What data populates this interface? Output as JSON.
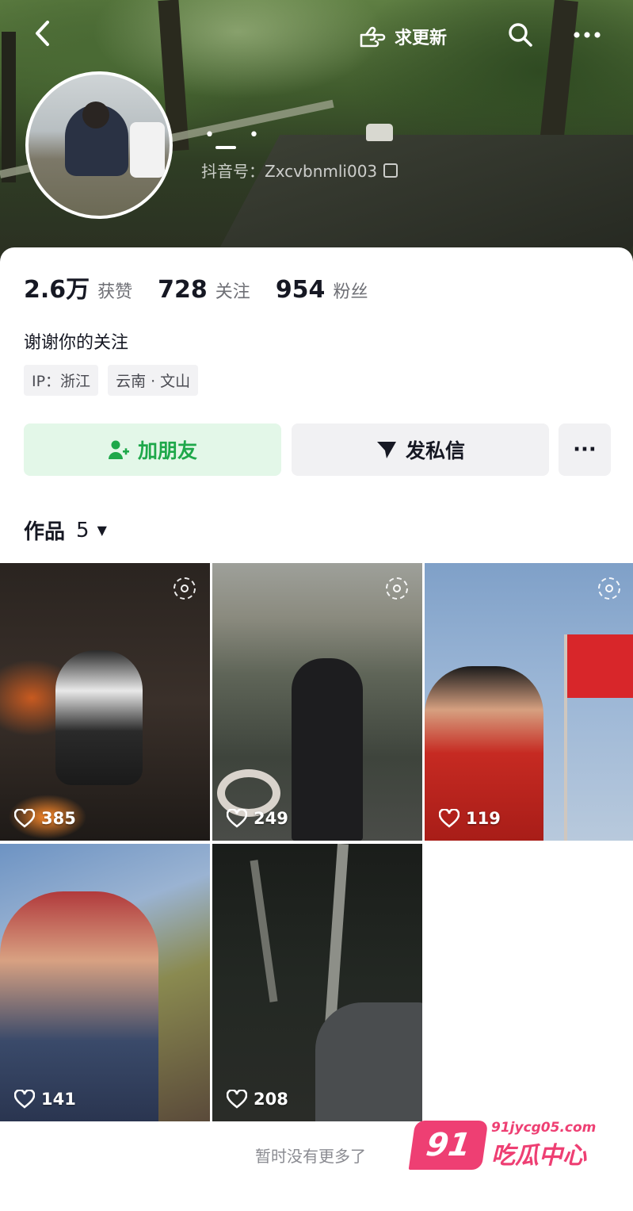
{
  "header": {
    "request_update_label": "求更新",
    "nickname_display": "• •",
    "douyin_id": "抖音号：Zxcvbnmli003"
  },
  "stats": [
    {
      "value": "2.6万",
      "label": "获赞"
    },
    {
      "value": "728",
      "label": "关注"
    },
    {
      "value": "954",
      "label": "粉丝"
    }
  ],
  "bio": "谢谢你的关注",
  "tags": [
    "IP：浙江",
    "云南 · 文山"
  ],
  "actions": {
    "add_friend": "加朋友",
    "message": "发私信",
    "more": "···"
  },
  "works": {
    "title": "作品",
    "count": "5",
    "caret": "▼",
    "items": [
      {
        "likes": "385",
        "live": true
      },
      {
        "likes": "249",
        "live": true
      },
      {
        "likes": "119",
        "live": true
      },
      {
        "likes": "141",
        "live": false
      },
      {
        "likes": "208",
        "live": false
      }
    ]
  },
  "footer": {
    "no_more": "暂时没有更多了"
  },
  "watermark": {
    "badge": "91",
    "url": "91jycg05.com",
    "name": "吃瓜中心"
  },
  "colors": {
    "accent_green": "#1ea84a",
    "watermark_pink": "#ee3f73"
  }
}
